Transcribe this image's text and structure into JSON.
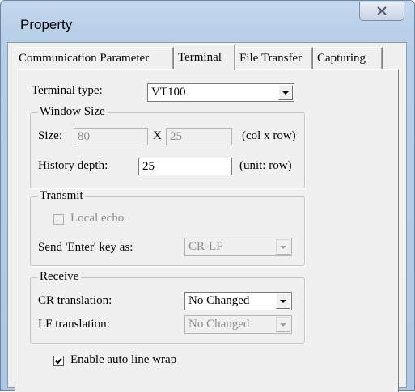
{
  "window": {
    "title": "Property",
    "close_icon": "close-icon"
  },
  "tabs": [
    {
      "label": "Communication Parameter",
      "active": false
    },
    {
      "label": "Terminal",
      "active": true
    },
    {
      "label": "File Transfer",
      "active": false
    },
    {
      "label": "Capturing",
      "active": false
    }
  ],
  "terminal": {
    "type_label": "Terminal type:",
    "type_value": "VT100"
  },
  "window_size": {
    "legend": "Window Size",
    "size_label": "Size:",
    "cols": "80",
    "x_label": "X",
    "rows": "25",
    "size_unit": "(col x row)",
    "history_label": "History depth:",
    "history_value": "25",
    "history_unit": "(unit: row)"
  },
  "transmit": {
    "legend": "Transmit",
    "local_echo_label": "Local echo",
    "local_echo_checked": false,
    "enter_label": "Send 'Enter' key  as:",
    "enter_value": "CR-LF"
  },
  "receive": {
    "legend": "Receive",
    "cr_label": "CR translation:",
    "cr_value": "No Changed",
    "lf_label": "LF translation:",
    "lf_value": "No Changed"
  },
  "wrap": {
    "label": "Enable auto line wrap",
    "checked": true
  }
}
